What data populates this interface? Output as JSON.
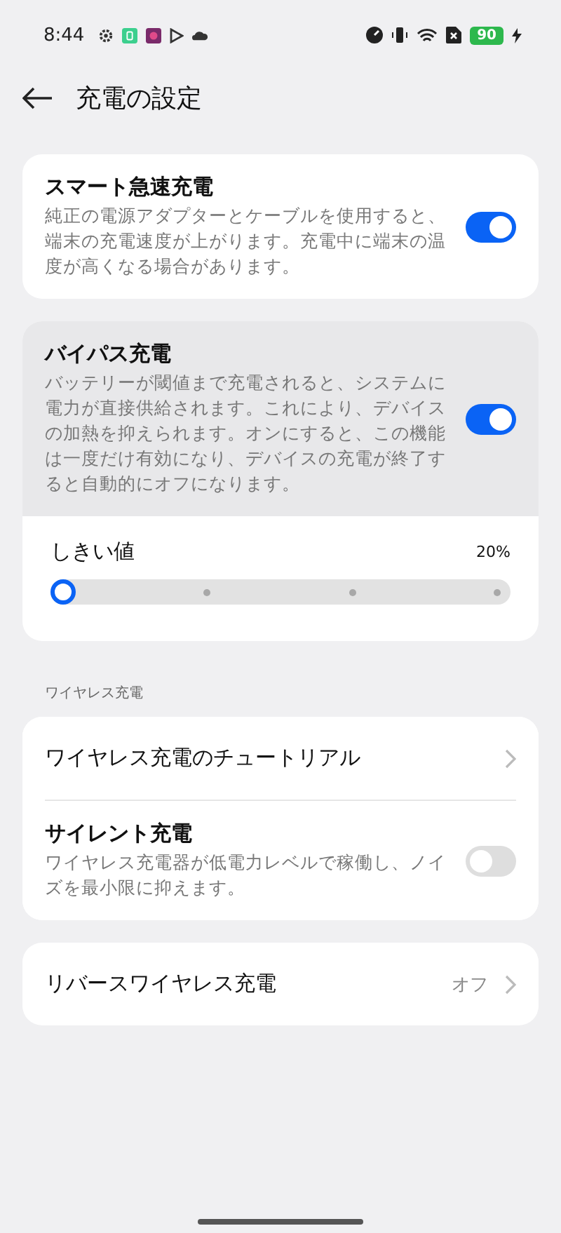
{
  "status_bar": {
    "time": "8:44",
    "battery": "90"
  },
  "header": {
    "title": "充電の設定"
  },
  "sections": [
    {
      "items": [
        {
          "kind": "toggle",
          "title": "スマート急速充電",
          "description": "純正の電源アダプターとケーブルを使用すると、端末の充電速度が上がります。充電中に端末の温度が高くなる場合があります。",
          "on": true,
          "highlighted": false
        }
      ]
    },
    {
      "items": [
        {
          "kind": "toggle",
          "title": "バイパス充電",
          "description": "バッテリーが閾値まで充電されると、システムに電力が直接供給されます。これにより、デバイスの加熱を抑えられます。オンにすると、この機能は一度だけ有効になり、デバイスの充電が終了すると自動的にオフになります。",
          "on": true,
          "highlighted": true
        },
        {
          "kind": "slider",
          "label": "しきい値",
          "reading": "20%",
          "level": 0
        }
      ]
    },
    {
      "header": "ワイヤレス充電",
      "items": [
        {
          "kind": "link",
          "title": "ワイヤレス充電のチュートリアル"
        },
        {
          "kind": "toggle",
          "title": "サイレント充電",
          "description": "ワイヤレス充電器が低電力レベルで稼働し、ノイズを最小限に抑えます。",
          "on": false,
          "highlighted": false
        }
      ]
    },
    {
      "items": [
        {
          "kind": "link",
          "title": "リバースワイヤレス充電",
          "value": "オフ"
        }
      ]
    }
  ]
}
